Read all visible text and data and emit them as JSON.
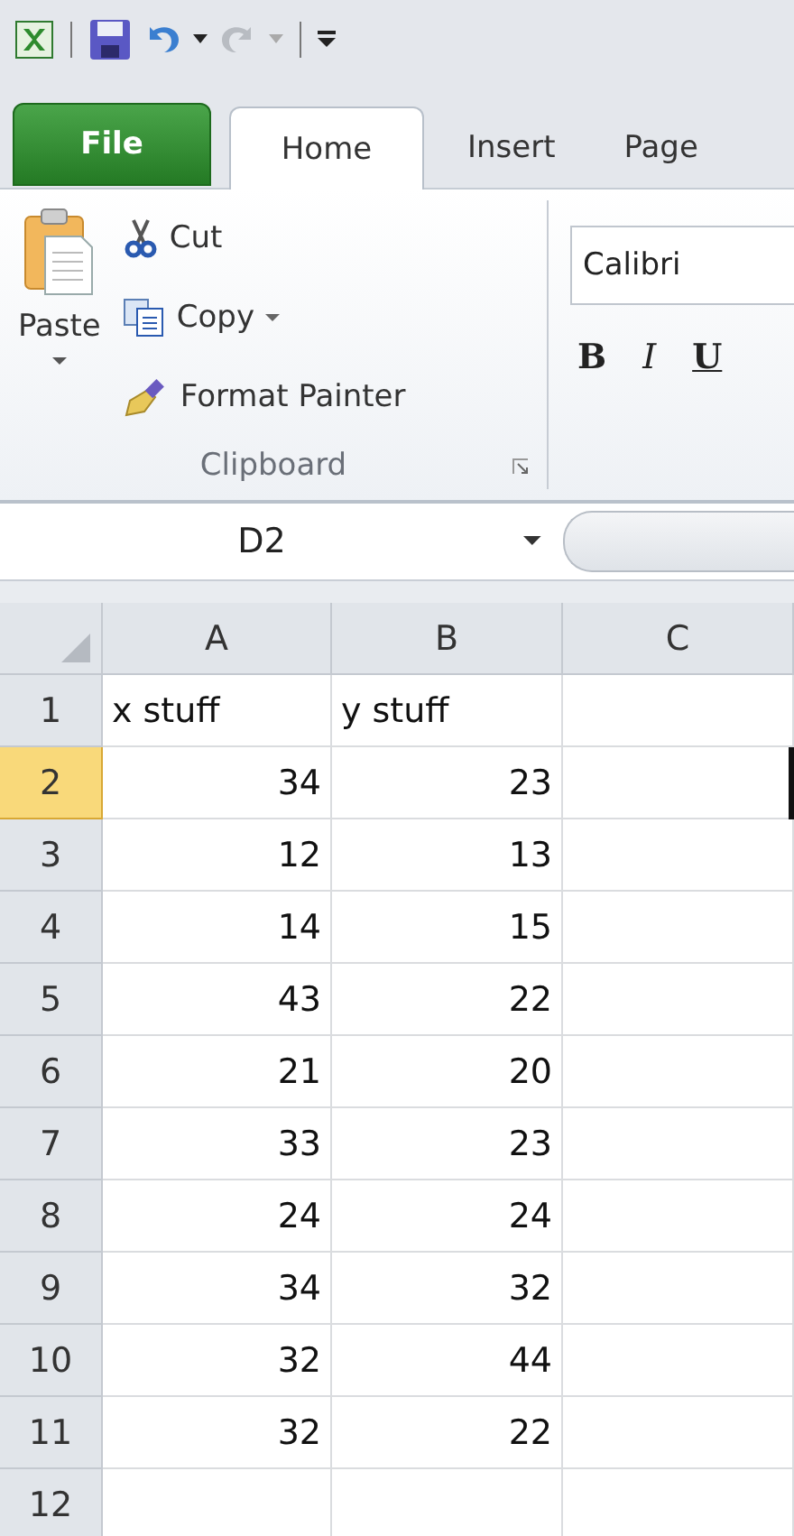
{
  "tabs": [
    {
      "label": "File",
      "kind": "file"
    },
    {
      "label": "Home",
      "kind": "tab",
      "selected": true
    },
    {
      "label": "Insert",
      "kind": "tab",
      "selected": false
    },
    {
      "label": "Page",
      "kind": "tab",
      "selected": false
    }
  ],
  "clipboard": {
    "paste": "Paste",
    "cut": "Cut",
    "copy": "Copy",
    "format_painter": "Format Painter",
    "group_label": "Clipboard"
  },
  "font": {
    "font_name": "Calibri",
    "bold": "B",
    "italic": "I",
    "underline": "U"
  },
  "name_box": {
    "value": "D2"
  },
  "sheet": {
    "columns": [
      {
        "label": "A",
        "selected": false
      },
      {
        "label": "B",
        "selected": false
      },
      {
        "label": "C",
        "selected": false
      }
    ],
    "rows": [
      {
        "number": "1",
        "selected": false,
        "kind": "text",
        "cells": [
          "x stuff",
          "y stuff"
        ]
      },
      {
        "number": "2",
        "selected": true,
        "kind": "number",
        "cells": [
          "34",
          "23"
        ]
      },
      {
        "number": "3",
        "selected": false,
        "kind": "number",
        "cells": [
          "12",
          "13"
        ]
      },
      {
        "number": "4",
        "selected": false,
        "kind": "number",
        "cells": [
          "14",
          "15"
        ]
      },
      {
        "number": "5",
        "selected": false,
        "kind": "number",
        "cells": [
          "43",
          "22"
        ]
      },
      {
        "number": "6",
        "selected": false,
        "kind": "number",
        "cells": [
          "21",
          "20"
        ]
      },
      {
        "number": "7",
        "selected": false,
        "kind": "number",
        "cells": [
          "33",
          "23"
        ]
      },
      {
        "number": "8",
        "selected": false,
        "kind": "number",
        "cells": [
          "24",
          "24"
        ]
      },
      {
        "number": "9",
        "selected": false,
        "kind": "number",
        "cells": [
          "34",
          "32"
        ]
      },
      {
        "number": "10",
        "selected": false,
        "kind": "number",
        "cells": [
          "32",
          "44"
        ]
      },
      {
        "number": "11",
        "selected": false,
        "kind": "number",
        "cells": [
          "32",
          "22"
        ]
      },
      {
        "number": "12",
        "selected": false
      }
    ]
  }
}
